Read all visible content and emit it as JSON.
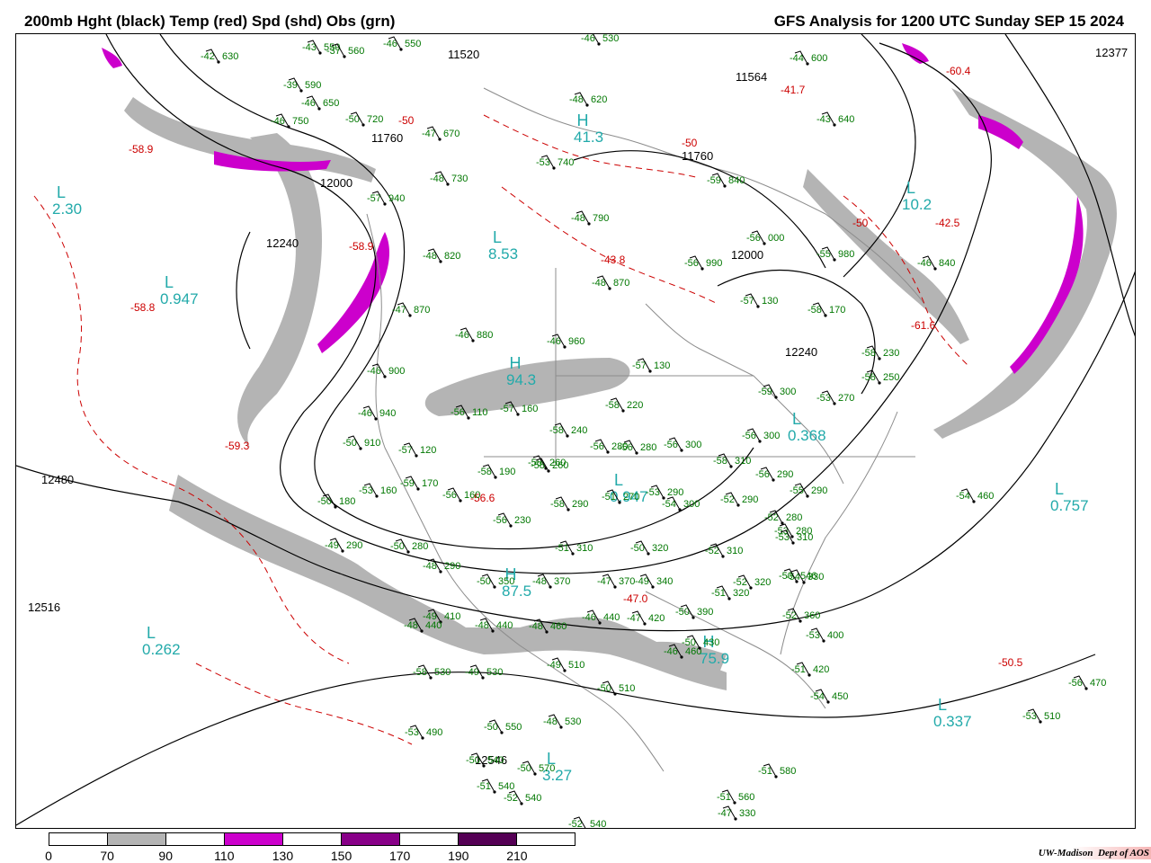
{
  "header": {
    "title_left": "200mb Hght (black) Temp (red) Spd (shd) Obs (grn)",
    "title_right": "GFS Analysis for 1200 UTC Sunday  SEP 15 2024"
  },
  "colors": {
    "height_contour": "#000000",
    "temp_contour": "#cc0000",
    "obs_text": "#007700",
    "speed_label": "#22aaaa",
    "land_border": "#888888",
    "shade_70_90": "#b4b4b4",
    "shade_110_130": "#cc00cc",
    "shade_150_170": "#880088",
    "shade_190_210": "#550055"
  },
  "colorbar": {
    "ticks": [
      "0",
      "70",
      "90",
      "110",
      "130",
      "150",
      "170",
      "190",
      "210"
    ],
    "segments": [
      "#ffffff",
      "#b4b4b4",
      "#ffffff",
      "#cc00cc",
      "#ffffff",
      "#880088",
      "#ffffff",
      "#550055",
      "#ffffff"
    ]
  },
  "height_labels": [
    {
      "text": "11520"
    },
    {
      "text": "11564"
    },
    {
      "text": "11760"
    },
    {
      "text": "11760"
    },
    {
      "text": "12000"
    },
    {
      "text": "12000"
    },
    {
      "text": "12240"
    },
    {
      "text": "12240"
    },
    {
      "text": "12480"
    },
    {
      "text": "12516"
    },
    {
      "text": "12377"
    },
    {
      "text": "12546"
    }
  ],
  "highs_lows": [
    {
      "type": "L",
      "value": "2.30"
    },
    {
      "type": "L",
      "value": "0.947"
    },
    {
      "type": "L",
      "value": "8.53"
    },
    {
      "type": "H",
      "value": "41.3"
    },
    {
      "type": "H",
      "value": "94.3"
    },
    {
      "type": "L",
      "value": "0.262"
    },
    {
      "type": "H",
      "value": "87.5"
    },
    {
      "type": "H",
      "value": "75.9"
    },
    {
      "type": "L",
      "value": "0.757"
    },
    {
      "type": "L",
      "value": "0.337"
    },
    {
      "type": "L",
      "value": "3.27"
    },
    {
      "type": "L",
      "value": "10.2"
    },
    {
      "type": "L",
      "value": "0.368"
    },
    {
      "type": "L",
      "value": "0.947"
    }
  ],
  "temp_labels": [
    {
      "text": "-58.9"
    },
    {
      "text": "-58.8"
    },
    {
      "text": "-59.3"
    },
    {
      "text": "-58.9"
    },
    {
      "text": "-50"
    },
    {
      "text": "-50"
    },
    {
      "text": "-43.8"
    },
    {
      "text": "-41.7"
    },
    {
      "text": "-42.5"
    },
    {
      "text": "-50"
    },
    {
      "text": "-60.4"
    },
    {
      "text": "-61.6"
    },
    {
      "text": "-47.0"
    },
    {
      "text": "-50.5"
    },
    {
      "text": "-56.6"
    }
  ],
  "obs": [
    "-42 630",
    "-43 550",
    "-46 550",
    "-46 530",
    "-37 560",
    "-39 590",
    "-46 650",
    "-46 750",
    "-50 720",
    "-47 670",
    "-48 620",
    "-44 600",
    "-43 640",
    "-53 740",
    "-59 840",
    "-48 730",
    "-57 940",
    "-48 790",
    "-48 820",
    "-56 990",
    "-56 000",
    "-55 980",
    "-46 840",
    "-48 870",
    "-47 870",
    "-57 130",
    "-58 170",
    "-58 230",
    "-58 250",
    "-46 880",
    "-46 960",
    "-57 130",
    "-59 300",
    "-53 270",
    "-58 220",
    "-56 110",
    "-57 160",
    "-46 900",
    "-46 940",
    "-50 910",
    "-57 120",
    "-58 240",
    "-56 280",
    "-58 260",
    "-56 280",
    "-56 300",
    "-58 310",
    "-56 300",
    "-56 290",
    "-55 290",
    "-58 190",
    "-58 260",
    "-59 170",
    "-56 160",
    "-53 160",
    "-50 180",
    "-58 290",
    "-51 270",
    "-53 290",
    "-54 300",
    "-52 290",
    "-52 280",
    "-54 460",
    "-56 230",
    "-49 290",
    "-50 280",
    "-48 290",
    "-51 310",
    "-50 320",
    "-52 310",
    "-53 280",
    "-53 310",
    "-50 350",
    "-48 370",
    "-47 370",
    "-49 340",
    "-51 320",
    "-52 320",
    "-54 330",
    "-49 410",
    "-48 440",
    "-48 440",
    "-48 460",
    "-46 440",
    "-47 420",
    "-50 390",
    "-52 360",
    "-53 400",
    "-58 530",
    "-49 530",
    "-49 510",
    "-50 510",
    "-46 460",
    "-50 430",
    "-51 420",
    "-54 450",
    "-56 470",
    "-53 510",
    "-53 490",
    "-50 550",
    "-48 530",
    "-50 540",
    "-50 570",
    "-52 540",
    "-52 540",
    "-51 560",
    "-51 580",
    "-51 540",
    "-50 546",
    "-47 330"
  ]
}
